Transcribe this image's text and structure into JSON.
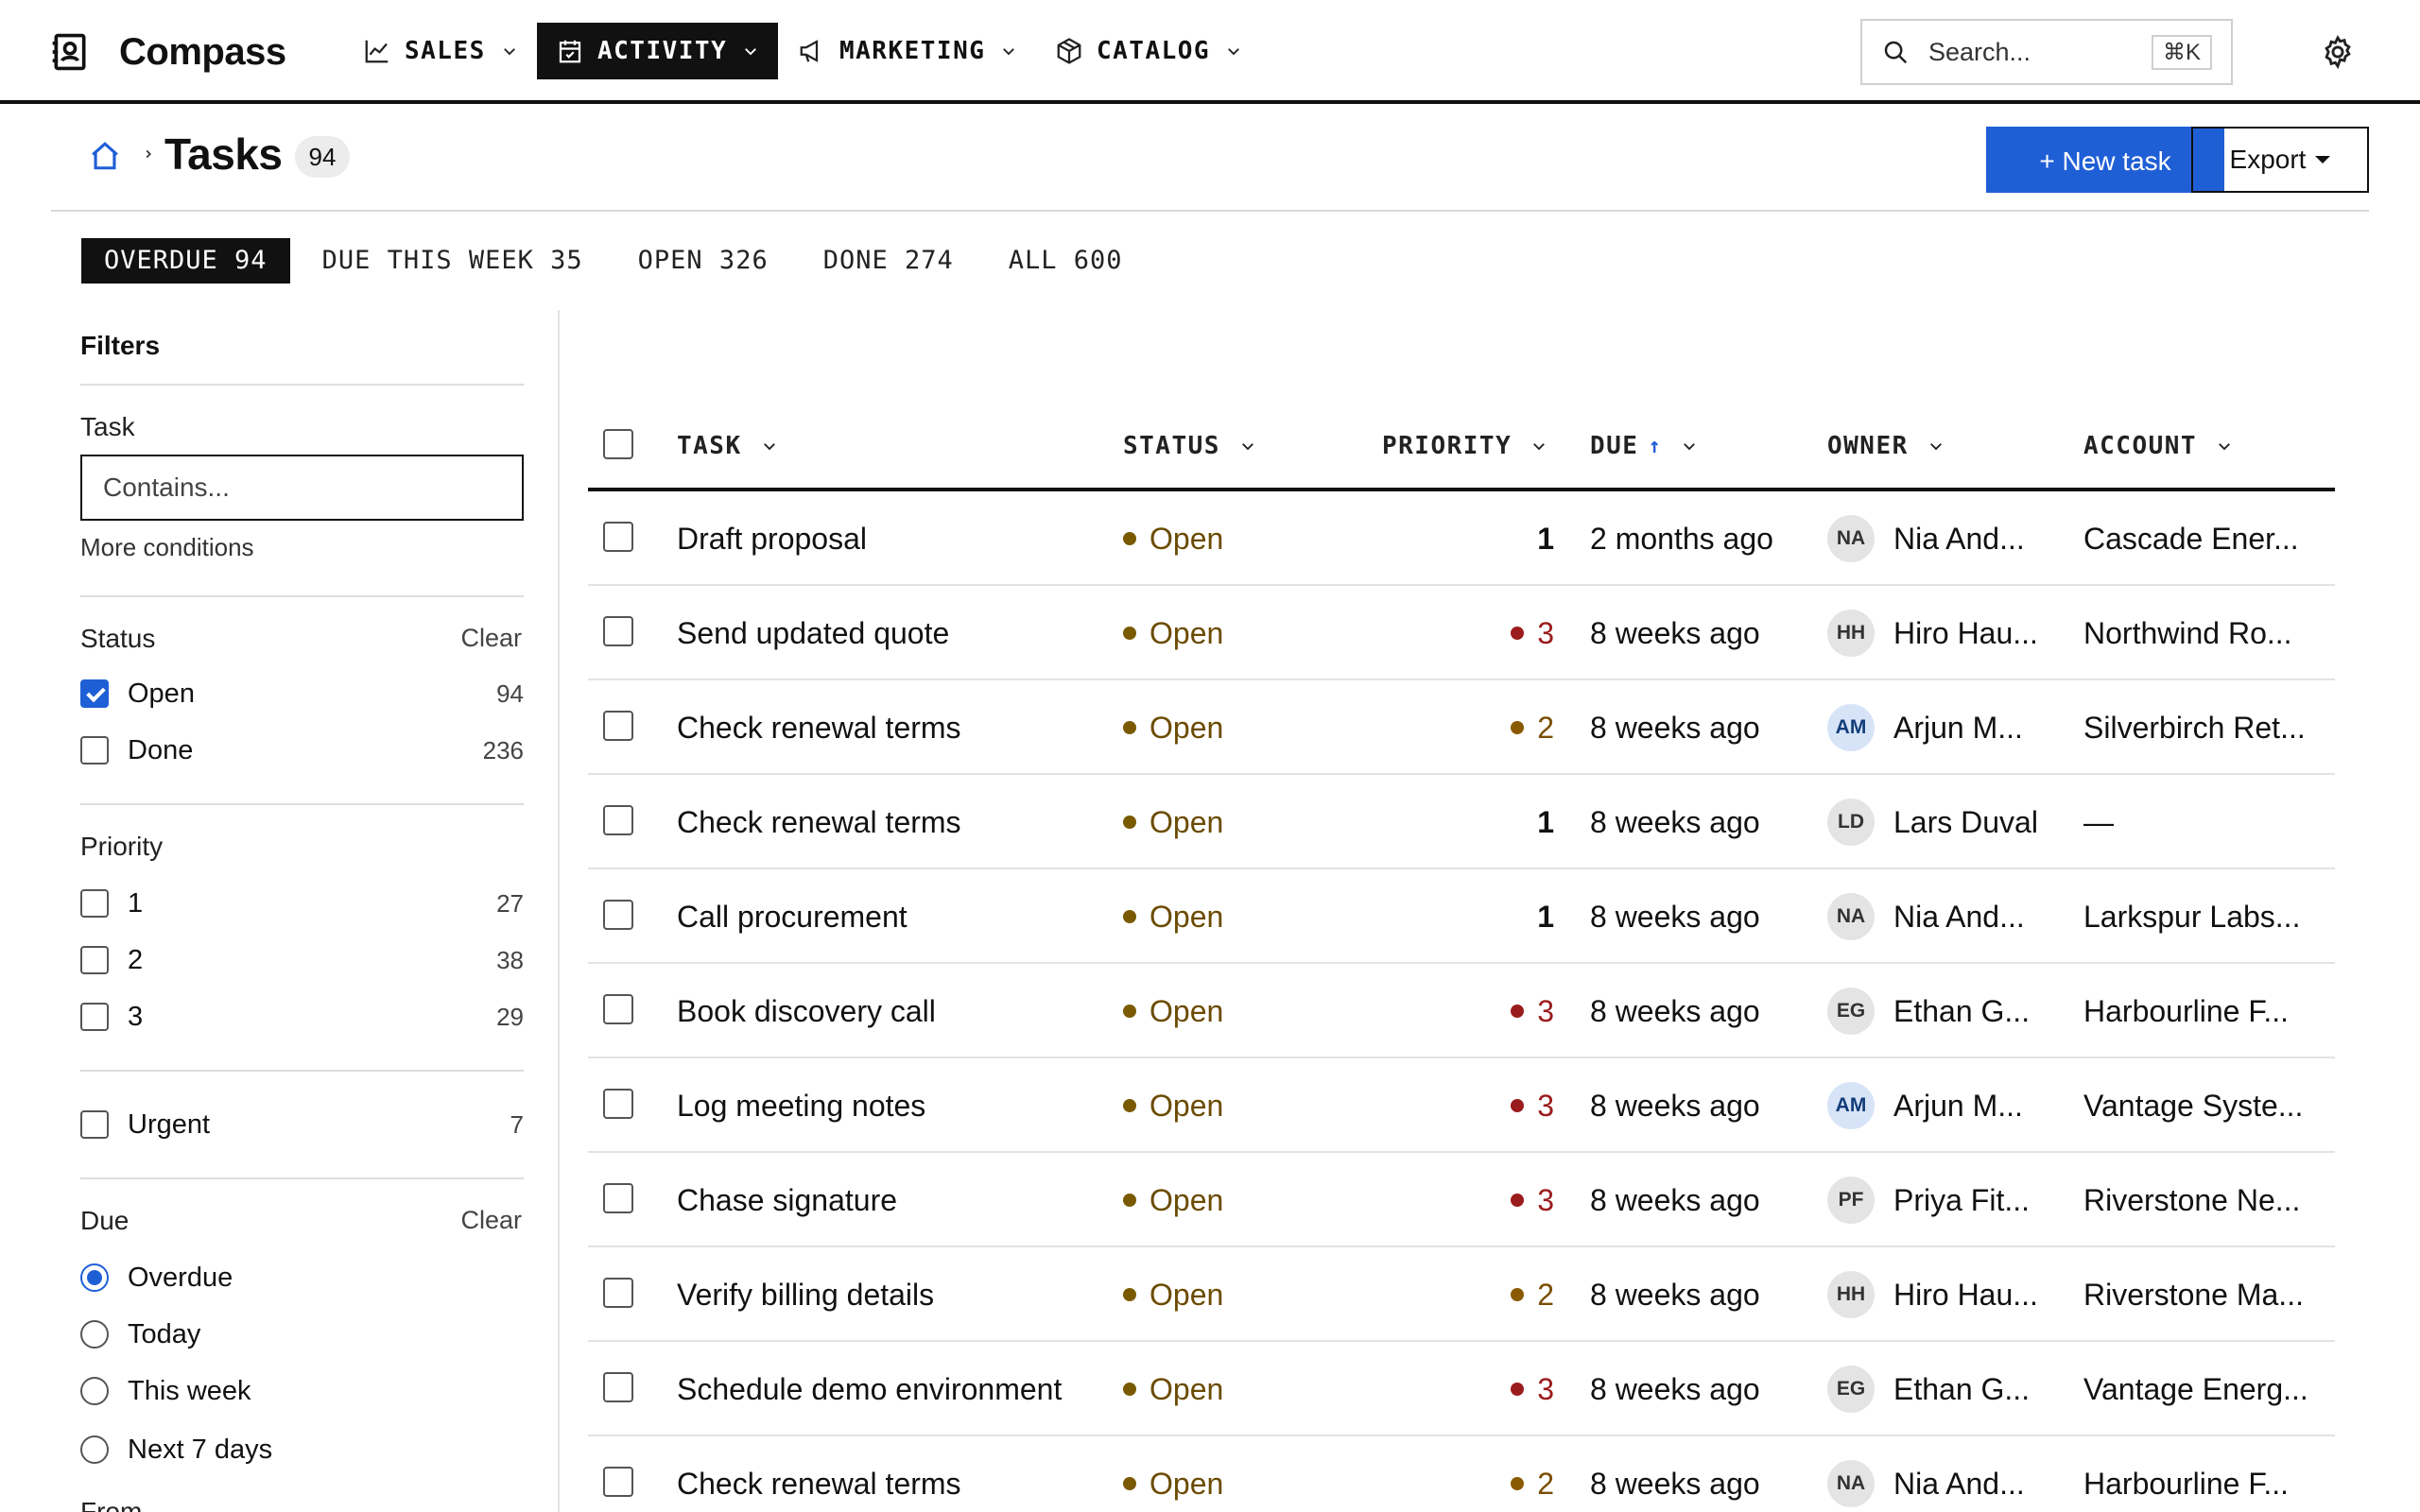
{
  "app": {
    "name": "Compass"
  },
  "nav": [
    {
      "label": "SALES",
      "icon": "chart-line-icon",
      "active": false
    },
    {
      "label": "ACTIVITY",
      "icon": "calendar-check-icon",
      "active": true
    },
    {
      "label": "MARKETING",
      "icon": "megaphone-icon",
      "active": false
    },
    {
      "label": "CATALOG",
      "icon": "box-icon",
      "active": false
    }
  ],
  "search": {
    "placeholder": "Search...",
    "shortcut": "⌘K"
  },
  "page": {
    "title": "Tasks",
    "count": "94",
    "new_button": "+ New task",
    "export_button": "Export"
  },
  "tabs": [
    {
      "label": "OVERDUE 94",
      "active": true
    },
    {
      "label": "DUE THIS WEEK 35",
      "active": false
    },
    {
      "label": "OPEN 326",
      "active": false
    },
    {
      "label": "DONE 274",
      "active": false
    },
    {
      "label": "ALL 600",
      "active": false
    }
  ],
  "filters": {
    "title": "Filters",
    "task": {
      "label": "Task",
      "placeholder": "Contains...",
      "more": "More conditions"
    },
    "status": {
      "label": "Status",
      "clear": "Clear",
      "options": [
        {
          "label": "Open",
          "count": "94",
          "checked": true
        },
        {
          "label": "Done",
          "count": "236",
          "checked": false
        }
      ]
    },
    "priority": {
      "label": "Priority",
      "options": [
        {
          "label": "1",
          "count": "27",
          "checked": false
        },
        {
          "label": "2",
          "count": "38",
          "checked": false
        },
        {
          "label": "3",
          "count": "29",
          "checked": false
        }
      ]
    },
    "urgent": {
      "label": "Urgent",
      "count": "7",
      "checked": false
    },
    "due": {
      "label": "Due",
      "clear": "Clear",
      "options": [
        {
          "label": "Overdue",
          "checked": true
        },
        {
          "label": "Today",
          "checked": false
        },
        {
          "label": "This week",
          "checked": false
        },
        {
          "label": "Next 7 days",
          "checked": false
        }
      ],
      "next_label": "From"
    }
  },
  "table": {
    "columns": {
      "task": "TASK",
      "status": "STATUS",
      "priority": "PRIORITY",
      "due": "DUE",
      "due_sort": "↑",
      "owner": "OWNER",
      "account": "ACCOUNT"
    },
    "rows": [
      {
        "task": "Draft proposal",
        "status": "Open",
        "priority": "1",
        "due": "2 months ago",
        "initials": "NA",
        "owner": "Nia And...",
        "account": "Cascade Ener..."
      },
      {
        "task": "Send updated quote",
        "status": "Open",
        "priority": "3",
        "due": "8 weeks ago",
        "initials": "HH",
        "owner": "Hiro Hau...",
        "account": "Northwind Ro..."
      },
      {
        "task": "Check renewal terms",
        "status": "Open",
        "priority": "2",
        "due": "8 weeks ago",
        "initials": "AM",
        "owner": "Arjun M...",
        "account": "Silverbirch Ret..."
      },
      {
        "task": "Check renewal terms",
        "status": "Open",
        "priority": "1",
        "due": "8 weeks ago",
        "initials": "LD",
        "owner": "Lars Duval",
        "account": "—"
      },
      {
        "task": "Call procurement",
        "status": "Open",
        "priority": "1",
        "due": "8 weeks ago",
        "initials": "NA",
        "owner": "Nia And...",
        "account": "Larkspur Labs..."
      },
      {
        "task": "Book discovery call",
        "status": "Open",
        "priority": "3",
        "due": "8 weeks ago",
        "initials": "EG",
        "owner": "Ethan G...",
        "account": "Harbourline F..."
      },
      {
        "task": "Log meeting notes",
        "status": "Open",
        "priority": "3",
        "due": "8 weeks ago",
        "initials": "AM",
        "owner": "Arjun M...",
        "account": "Vantage Syste..."
      },
      {
        "task": "Chase signature",
        "status": "Open",
        "priority": "3",
        "due": "8 weeks ago",
        "initials": "PF",
        "owner": "Priya Fit...",
        "account": "Riverstone Ne..."
      },
      {
        "task": "Verify billing details",
        "status": "Open",
        "priority": "2",
        "due": "8 weeks ago",
        "initials": "HH",
        "owner": "Hiro Hau...",
        "account": "Riverstone Ma..."
      },
      {
        "task": "Schedule demo environment",
        "status": "Open",
        "priority": "3",
        "due": "8 weeks ago",
        "initials": "EG",
        "owner": "Ethan G...",
        "account": "Vantage Energ..."
      },
      {
        "task": "Check renewal terms",
        "status": "Open",
        "priority": "2",
        "due": "8 weeks ago",
        "initials": "NA",
        "owner": "Nia And...",
        "account": "Harbourline F..."
      }
    ]
  },
  "colors": {
    "accent": "#1f5fd6",
    "status_open": "#6b4b00",
    "priority_high": "#9b1c1c",
    "priority_mid": "#7a4e00"
  }
}
